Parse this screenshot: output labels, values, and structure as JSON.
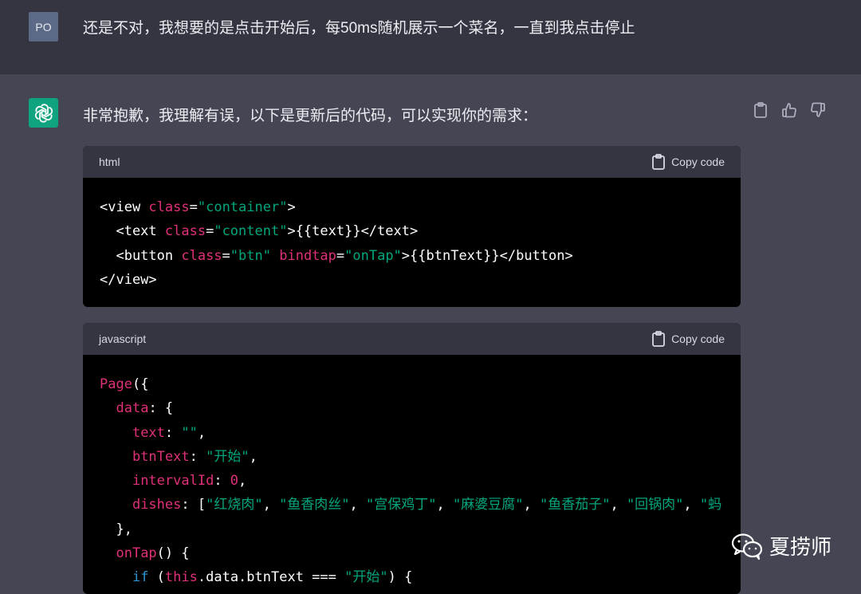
{
  "user": {
    "avatar": "PO",
    "message": "还是不对，我想要的是点击开始后，每50ms随机展示一个菜名，一直到我点击停止"
  },
  "assistant": {
    "avatar_icon": "openai-logo-icon",
    "message": "非常抱歉，我理解有误，以下是更新后的代码，可以实现你的需求："
  },
  "actions": {
    "copy_icon": "clipboard-icon",
    "like_icon": "thumbs-up-icon",
    "dislike_icon": "thumbs-down-icon"
  },
  "blocks": [
    {
      "language": "html",
      "copy_label": "Copy code",
      "lines": [
        [
          [
            "tag",
            "<view "
          ],
          [
            "attr",
            "class"
          ],
          [
            "plain",
            "="
          ],
          [
            "str",
            "\"container\""
          ],
          [
            "tag",
            ">"
          ]
        ],
        [
          [
            "tag",
            "  <text "
          ],
          [
            "attr",
            "class"
          ],
          [
            "plain",
            "="
          ],
          [
            "str",
            "\"content\""
          ],
          [
            "tag",
            ">{{text}}</text>"
          ]
        ],
        [
          [
            "tag",
            "  <button "
          ],
          [
            "attr",
            "class"
          ],
          [
            "plain",
            "="
          ],
          [
            "str",
            "\"btn\""
          ],
          [
            "plain",
            " "
          ],
          [
            "attr",
            "bindtap"
          ],
          [
            "plain",
            "="
          ],
          [
            "str",
            "\"onTap\""
          ],
          [
            "tag",
            ">{{btnText}}</button>"
          ]
        ],
        [
          [
            "tag",
            "</view>"
          ]
        ]
      ]
    },
    {
      "language": "javascript",
      "copy_label": "Copy code",
      "lines": [
        [
          [
            "attr",
            "Page"
          ],
          [
            "plain",
            "({"
          ]
        ],
        [
          [
            "plain",
            "  "
          ],
          [
            "attr",
            "data"
          ],
          [
            "plain",
            ": {"
          ]
        ],
        [
          [
            "plain",
            "    "
          ],
          [
            "attr",
            "text"
          ],
          [
            "plain",
            ": "
          ],
          [
            "str",
            "\"\""
          ],
          [
            "plain",
            ","
          ]
        ],
        [
          [
            "plain",
            "    "
          ],
          [
            "attr",
            "btnText"
          ],
          [
            "plain",
            ": "
          ],
          [
            "str",
            "\"开始\""
          ],
          [
            "plain",
            ","
          ]
        ],
        [
          [
            "plain",
            "    "
          ],
          [
            "attr",
            "intervalId"
          ],
          [
            "plain",
            ": "
          ],
          [
            "num",
            "0"
          ],
          [
            "plain",
            ","
          ]
        ],
        [
          [
            "plain",
            "    "
          ],
          [
            "attr",
            "dishes"
          ],
          [
            "plain",
            ": ["
          ],
          [
            "str",
            "\"红烧肉\""
          ],
          [
            "plain",
            ", "
          ],
          [
            "str",
            "\"鱼香肉丝\""
          ],
          [
            "plain",
            ", "
          ],
          [
            "str",
            "\"宫保鸡丁\""
          ],
          [
            "plain",
            ", "
          ],
          [
            "str",
            "\"麻婆豆腐\""
          ],
          [
            "plain",
            ", "
          ],
          [
            "str",
            "\"鱼香茄子\""
          ],
          [
            "plain",
            ", "
          ],
          [
            "str",
            "\"回锅肉\""
          ],
          [
            "plain",
            ", "
          ],
          [
            "str",
            "\"蚂"
          ]
        ],
        [
          [
            "plain",
            "  },"
          ]
        ],
        [
          [
            "plain",
            "  "
          ],
          [
            "attr",
            "onTap"
          ],
          [
            "plain",
            "() {"
          ]
        ],
        [
          [
            "plain",
            "    "
          ],
          [
            "kw",
            "if"
          ],
          [
            "plain",
            " ("
          ],
          [
            "attr",
            "this"
          ],
          [
            "plain",
            ".data.btnText === "
          ],
          [
            "str",
            "\"开始\""
          ],
          [
            "plain",
            ") {"
          ]
        ]
      ]
    }
  ],
  "watermark": {
    "icon": "wechat-icon",
    "text": "夏捞师"
  }
}
